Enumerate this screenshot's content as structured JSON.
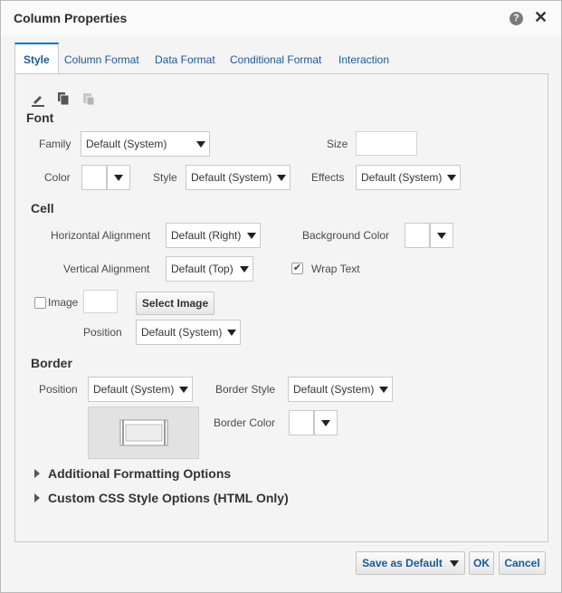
{
  "dialog": {
    "title": "Column Properties"
  },
  "tabs": [
    "Style",
    "Column Format",
    "Data Format",
    "Conditional Format",
    "Interaction"
  ],
  "toolbar": {
    "icons": [
      "edit-icon",
      "copy-icon",
      "paste-icon"
    ]
  },
  "font": {
    "section": "Font",
    "family_label": "Family",
    "family_value": "Default (System)",
    "size_label": "Size",
    "size_value": "",
    "color_label": "Color",
    "style_label": "Style",
    "style_value": "Default (System)",
    "effects_label": "Effects",
    "effects_value": "Default (System)"
  },
  "cell": {
    "section": "Cell",
    "h_align_label": "Horizontal Alignment",
    "h_align_value": "Default (Right)",
    "bg_color_label": "Background Color",
    "v_align_label": "Vertical Alignment",
    "v_align_value": "Default (Top)",
    "wrap_text_label": "Wrap Text",
    "wrap_text_checked": true,
    "image_label": "Image",
    "image_checked": false,
    "select_image_label": "Select Image",
    "position_label": "Position",
    "position_value": "Default (System)"
  },
  "border": {
    "section": "Border",
    "position_label": "Position",
    "position_value": "Default (System)",
    "style_label": "Border Style",
    "style_value": "Default (System)",
    "color_label": "Border Color"
  },
  "expanders": {
    "additional": "Additional Formatting Options",
    "custom_css": "Custom CSS Style Options (HTML Only)"
  },
  "footer": {
    "save_default": "Save as Default",
    "ok": "OK",
    "cancel": "Cancel"
  },
  "colors": {
    "accent": "#0572ce",
    "link": "#1a5a96",
    "panel": "#f4f4f4"
  }
}
